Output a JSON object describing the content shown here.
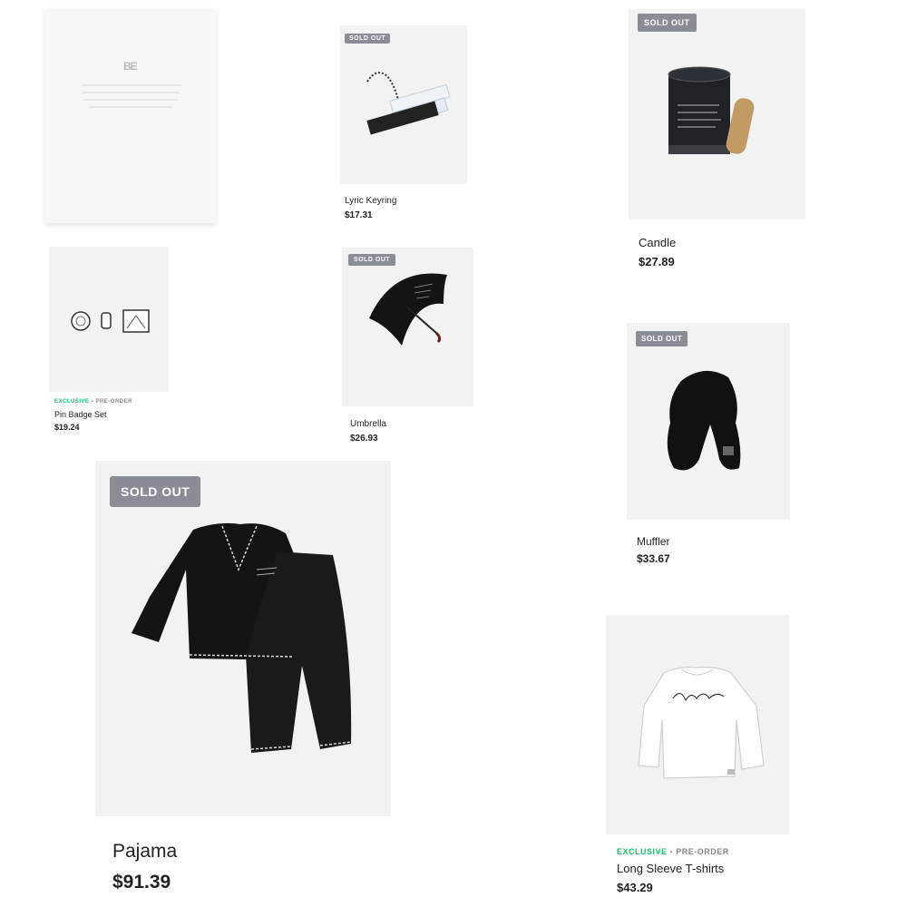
{
  "colors": {
    "badge_bg": "#8a8d96",
    "exclusive": "#1fbf6c",
    "tile_bg": "#f2f2f2"
  },
  "products": {
    "letter": {
      "logo_text": "BE",
      "icon": "album-letter-image"
    },
    "keyring": {
      "badge": "SOLD OUT",
      "name": "Lyric Keyring",
      "price": "$17.31",
      "icon": "keyring-image"
    },
    "candle": {
      "badge": "SOLD OUT",
      "name": "Candle",
      "price": "$27.89",
      "icon": "candle-image"
    },
    "pin": {
      "tag_exclusive": "EXCLUSIVE",
      "tag_sep": "•",
      "tag_preorder": "PRE-ORDER",
      "name": "Pin Badge Set",
      "price": "$19.24",
      "icon": "pin-badge-image"
    },
    "umbrella": {
      "badge": "SOLD OUT",
      "name": "Umbrella",
      "price": "$26.93",
      "icon": "umbrella-image"
    },
    "muffler": {
      "badge": "SOLD OUT",
      "name": "Muffler",
      "price": "$33.67",
      "icon": "muffler-image"
    },
    "pajama": {
      "badge": "SOLD OUT",
      "name": "Pajama",
      "price": "$91.39",
      "icon": "pajama-image"
    },
    "tshirt": {
      "tag_exclusive": "EXCLUSIVE",
      "tag_sep": "•",
      "tag_preorder": "PRE-ORDER",
      "name": "Long Sleeve T-shirts",
      "price": "$43.29",
      "icon": "tshirt-image"
    }
  }
}
